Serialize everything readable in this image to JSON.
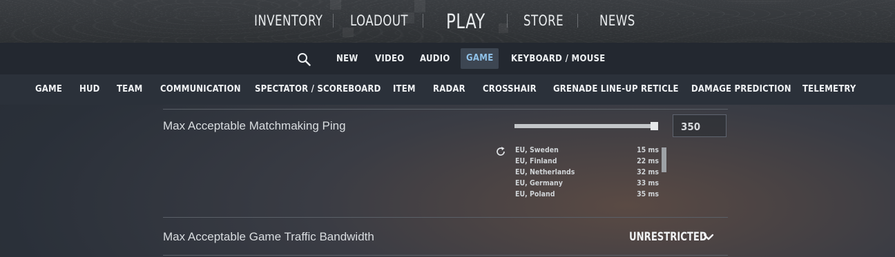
{
  "top_nav": {
    "items": [
      "INVENTORY",
      "LOADOUT",
      "PLAY",
      "STORE",
      "NEWS"
    ]
  },
  "settings_tabs": {
    "search_icon": "search-icon",
    "items": [
      "NEW",
      "VIDEO",
      "AUDIO",
      "GAME",
      "KEYBOARD / MOUSE"
    ],
    "active": "GAME"
  },
  "game_categories": {
    "items": [
      "GAME",
      "HUD",
      "TEAM",
      "COMMUNICATION",
      "SPECTATOR / SCOREBOARD",
      "ITEM",
      "RADAR",
      "CROSSHAIR",
      "GRENADE LINE-UP RETICLE",
      "DAMAGE PREDICTION",
      "TELEMETRY"
    ]
  },
  "settings": {
    "ping": {
      "label": "Max Acceptable Matchmaking Ping",
      "value": "350",
      "slider_fraction": 1.0,
      "servers": [
        {
          "name": "EU, Sweden",
          "ms": "15 ms"
        },
        {
          "name": "EU, Finland",
          "ms": "22 ms"
        },
        {
          "name": "EU, Netherlands",
          "ms": "32 ms"
        },
        {
          "name": "EU, Germany",
          "ms": "33 ms"
        },
        {
          "name": "EU, Poland",
          "ms": "35 ms"
        }
      ]
    },
    "bandwidth": {
      "label": "Max Acceptable Game Traffic Bandwidth",
      "value": "UNRESTRICTED"
    }
  },
  "colors": {
    "active_tab_text": "#8fc1e8",
    "active_tab_bg": "#3d4652"
  }
}
